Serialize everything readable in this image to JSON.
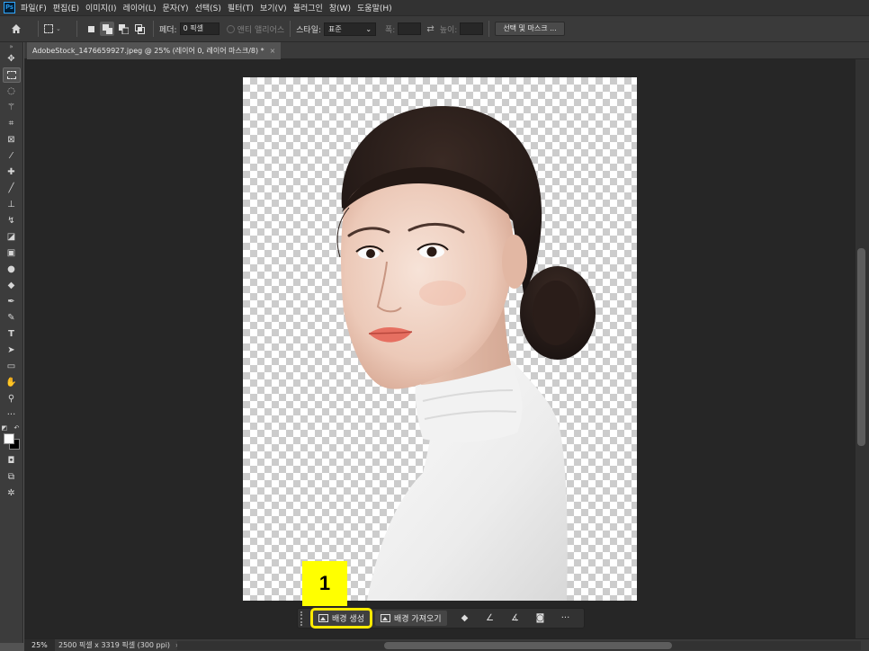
{
  "app": {
    "logo_text": "Ps",
    "menu": [
      "파일(F)",
      "편집(E)",
      "이미지(I)",
      "레이어(L)",
      "문자(Y)",
      "선택(S)",
      "필터(T)",
      "보기(V)",
      "플러그인",
      "창(W)",
      "도움말(H)"
    ]
  },
  "options": {
    "feather_label": "페더:",
    "feather_value": "0 픽셀",
    "antialias_label": "앤티 앨리어스",
    "style_label": "스타일:",
    "style_value": "표준",
    "width_label": "폭:",
    "height_label": "높이:",
    "select_mask_label": "선택 및 마스크 ..."
  },
  "document": {
    "tab_title": "AdobeStock_1476659927.jpeg @ 25% (레이어 0, 레이어 마스크/8) *",
    "close_glyph": "×"
  },
  "taskbar": {
    "generate_bg_label": "배경 생성",
    "import_bg_label": "배경 가져오기",
    "more_glyph": "···"
  },
  "annotation": {
    "step_number": "1",
    "highlight_color": "#ffea00"
  },
  "status": {
    "zoom": "25%",
    "doc_info": "2500 픽셀 x 3319 픽셀 (300 ppi)",
    "arrow": "›"
  },
  "colors": {
    "foreground": "#ffffff",
    "background": "#000000"
  }
}
